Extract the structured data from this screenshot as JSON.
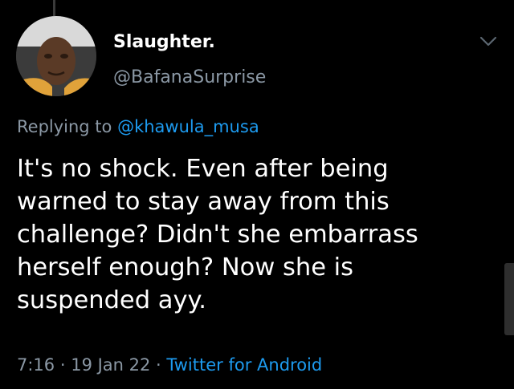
{
  "author": {
    "display_name": "Slaughter.",
    "handle": "@BafanaSurprise"
  },
  "reply": {
    "prefix": "Replying to ",
    "handle": "@khawula_musa"
  },
  "tweet": {
    "text": "It's no shock. Even after being\nwarned to stay away from this\nchallenge? Didn't she embarrass\nherself enough? Now she is\nsuspended ayy."
  },
  "meta": {
    "time": "7:16",
    "separator": " · ",
    "date": "19 Jan 22",
    "source": "Twitter for Android"
  },
  "icons": {
    "more": "chevron-down-icon",
    "avatar": "profile-photo"
  },
  "colors": {
    "background": "#000000",
    "primary_text": "#ffffff",
    "secondary_text": "#8b98a5",
    "link": "#1d9bf0"
  }
}
